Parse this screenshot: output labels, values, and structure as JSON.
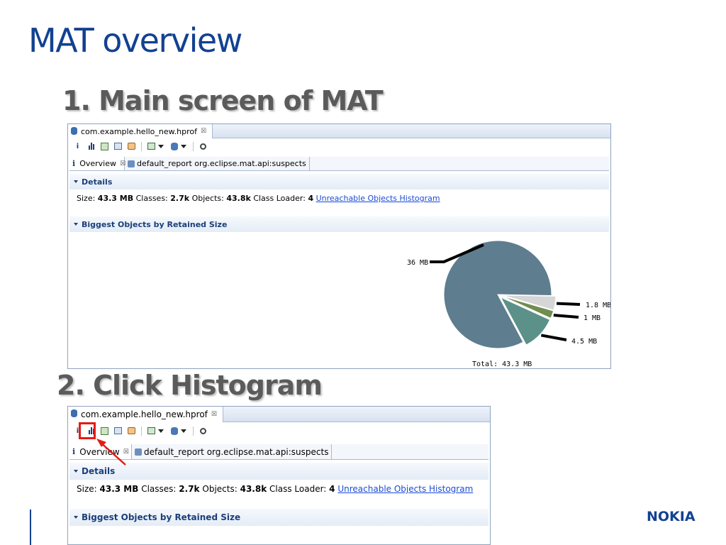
{
  "slide": {
    "title": "MAT overview",
    "step1_heading": "1. Main screen of MAT",
    "step2_heading": "2. Click Histogram",
    "logo_text": "NOKIA"
  },
  "window": {
    "file_tab": "com.example.hello_new.hprof",
    "close_glyph": "☒",
    "toolbar_icons": [
      "info-icon",
      "histogram-icon",
      "dominator-tree-icon",
      "top-consumers-icon",
      "duplicate-classes-icon",
      "run-report-icon",
      "oql-icon",
      "search-icon"
    ],
    "tabs": {
      "overview": "Overview",
      "default_report": "default_report  org.eclipse.mat.api:suspects"
    },
    "info_glyph": "i",
    "details": {
      "header": "Details",
      "size_label": "Size:",
      "size_value": "43.3 MB",
      "classes_label": "Classes:",
      "classes_value": "2.7k",
      "objects_label": "Objects:",
      "objects_value": "43.8k",
      "loader_label": "Class Loader:",
      "loader_value": "4",
      "link": "Unreachable Objects Histogram"
    },
    "biggest_header": "Biggest Objects by Retained Size"
  },
  "chart_data": {
    "type": "pie",
    "values": [
      36,
      1.8,
      1,
      4.5
    ],
    "labels": [
      "36 MB",
      "1.8 MB",
      "1 MB",
      "4.5 MB"
    ],
    "colors": [
      "#5e7d8f",
      "#d6d6d6",
      "#6f8d4f",
      "#5b9189"
    ],
    "total_label": "Total: 43.3 MB"
  }
}
